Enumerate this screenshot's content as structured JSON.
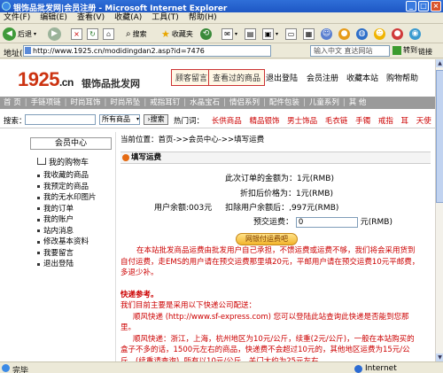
{
  "window": {
    "title": "银饰品批发网|会员注册 - Microsoft Internet Explorer",
    "min_icon": "minimize-icon",
    "max_icon": "maximize-icon",
    "close_icon": "close-icon"
  },
  "menubar": [
    "文件(F)",
    "编辑(E)",
    "查看(V)",
    "收藏(A)",
    "工具(T)",
    "帮助(H)"
  ],
  "toolbar": {
    "back_label": "后退",
    "search_label": "搜索",
    "favorites_label": "收藏夹"
  },
  "addressbar": {
    "label": "地址(D)",
    "url": "http://www.1925.cn/modidingdan2.asp?id=7476",
    "ime_placeholder": "输入中文 直达网站",
    "go_label": "转到",
    "links_label": "链接"
  },
  "site": {
    "logo_main": "1925",
    "logo_cn": ".cn",
    "logo_sub": "银饰品批发网",
    "top_links": [
      "顾客留言",
      "查看过的商品",
      "退出登陆",
      "会员注册",
      "收藏本站",
      "购物帮助"
    ],
    "nav": [
      "首 页",
      "手链项链",
      "时尚耳饰",
      "时尚吊坠",
      "戒指耳钉",
      "水晶宝石",
      "情侣系列",
      "配件包装",
      "儿童系列",
      "其 他"
    ],
    "search": {
      "label": "搜索：",
      "select_value": "所有商品",
      "button": "搜索",
      "hot_label": "热门词：",
      "hot_words": [
        "长供商品",
        "精品银饰",
        "男士饰品",
        "毛衣链",
        "手镯",
        "戒指",
        "耳",
        "天使"
      ]
    }
  },
  "sidebar": {
    "title": "会员中心",
    "cart": "我的购物车",
    "items": [
      "我收藏的商品",
      "我预定的商品",
      "我的无水印图片",
      "我的订单",
      "我的账户",
      "站内消息",
      "修改基本资料",
      "我要留言",
      "退出登陆"
    ]
  },
  "content": {
    "breadcrumb": "当前位置：首页->>会员中心->>填写运费",
    "section_title": "填写运费",
    "order_total_label": "此次订单的金额为：",
    "order_total_value": "1元(RMB)",
    "discount_label": "折扣后价格为：",
    "discount_value": "1元(RMB)",
    "balance_label": "用户余额:",
    "balance_value": "003元",
    "after_label": "扣除用户余额后：",
    "after_value": ",997元(RMB)",
    "prepay_label": "预交运费：",
    "prepay_value": "0",
    "prepay_unit": "元(RMB)",
    "pay_button": "网银付运费吧"
  },
  "notice": {
    "p1": "在本站批发商品运费由批发用户自己承担，不馈运费或运费不够，我们将会采用货到自付运费，走EMS的用户请在预交运费那里填20元，平邮用户请在预交运费10元平邮费，多退少补。",
    "title": "快递参考。",
    "p2": "我们目前主要是采用以下快递公司配送：",
    "p3": "顺风快递 (http://www.sf-express.com) 您可以登陆此站查询此快递是否能到您那里。",
    "p4": "顺风快递：浙江，上海，杭州地区为10元/公斤，续重(2元/公斤)，一般在本站购买的盒子不多的话，1500元左右的商品，快递费不会超过10元的，其他地区运费为15元/公斤，(续重请查询), 所有以10元/公斤，关门大约为25元左右。"
  },
  "status": {
    "left": "完毕",
    "zone": "Internet"
  }
}
